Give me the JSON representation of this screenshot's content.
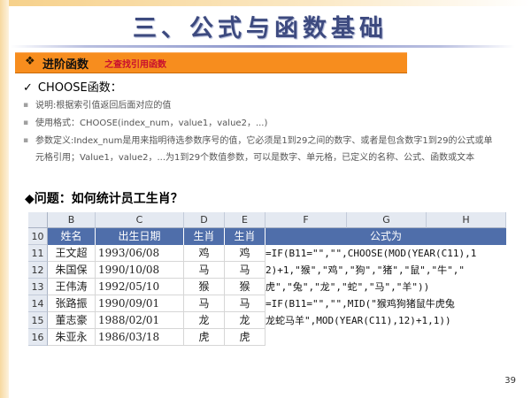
{
  "title": "三、公式与函数基础",
  "section": {
    "bullet": "❖",
    "main": "进阶函数",
    "sub": "之查找引用函数"
  },
  "function_line": {
    "check": "✓",
    "text": "CHOOSE函数："
  },
  "bullets": [
    {
      "dot": "▪",
      "text": "说明:根据索引值返回后面对应的值"
    },
    {
      "dot": "▪",
      "text": "使用格式：CHOOSE(index_num，value1，value2，...)"
    },
    {
      "dot": "▪",
      "text": "参数定义:Index_num是用来指明待选参数序号的值，它必须是1到29之间的数字、或者是包含数字1到29的公式或单元格引用；Value1，value2，...为1到29个数值参数，可以是数字、单元格，已定义的名称、公式、函数或文本"
    }
  ],
  "question": "◆问题：如何统计员工生肖？",
  "sheet": {
    "columns": [
      "B",
      "C",
      "D",
      "E",
      "F",
      "G",
      "H"
    ],
    "row_numbers": [
      "10",
      "11",
      "12",
      "13",
      "14",
      "15",
      "16"
    ],
    "header": {
      "name": "姓名",
      "date": "出生日期",
      "zodiac1": "生肖",
      "zodiac2": "生肖",
      "formula": "公式为"
    },
    "rows": [
      {
        "name": "王文超",
        "date": "1993/06/08",
        "z1": "鸡",
        "z2": "鸡"
      },
      {
        "name": "朱国保",
        "date": "1990/10/08",
        "z1": "马",
        "z2": "马"
      },
      {
        "name": "王伟涛",
        "date": "1992/05/10",
        "z1": "猴",
        "z2": "猴"
      },
      {
        "name": "张路振",
        "date": "1990/09/01",
        "z1": "马",
        "z2": "马"
      },
      {
        "name": "董志豪",
        "date": "1988/02/01",
        "z1": "龙",
        "z2": "龙"
      },
      {
        "name": "朱亚永",
        "date": "1986/03/18",
        "z1": "虎",
        "z2": "虎"
      }
    ],
    "formula_lines": [
      "=IF(B11=\"\",\"\",CHOOSE(MOD(YEAR(C11),1",
      "2)+1,\"猴\",\"鸡\",\"狗\",\"猪\",\"鼠\",\"牛\",\"",
      "虎\",\"兔\",\"龙\",\"蛇\",\"马\",\"羊\"))",
      "=IF(B11=\"\",\"\",MID(\"猴鸡狗猪鼠牛虎兔",
      "龙蛇马羊\",MOD(YEAR(C11),12)+1,1))"
    ]
  },
  "page_number": "39",
  "colors": {
    "accent_orange": "#f78d1e",
    "title_blue": "#3d4a7f",
    "header_fill": "#4f6eaa"
  }
}
